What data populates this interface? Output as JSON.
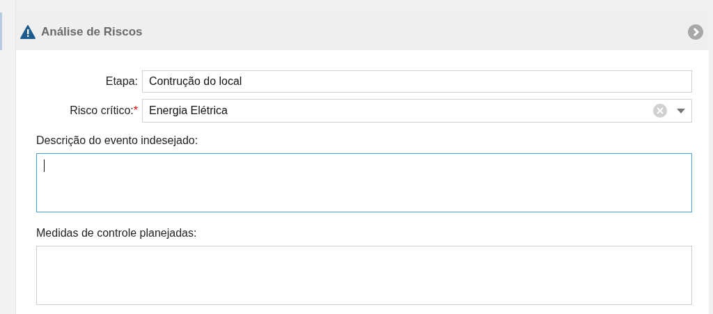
{
  "panel": {
    "title": "Análise de Riscos"
  },
  "fields": [
    {
      "kind": "text",
      "label": "Etapa:",
      "value": "Contrução do local"
    },
    {
      "kind": "select",
      "label": "Risco crítico:",
      "required_mark": "*",
      "value": "Energia Elétrica"
    },
    {
      "kind": "textarea",
      "label": "Descrição do evento indesejado:",
      "focused": true
    },
    {
      "kind": "textarea",
      "label": "Medidas de controle planejadas:",
      "focused": false
    }
  ]
}
